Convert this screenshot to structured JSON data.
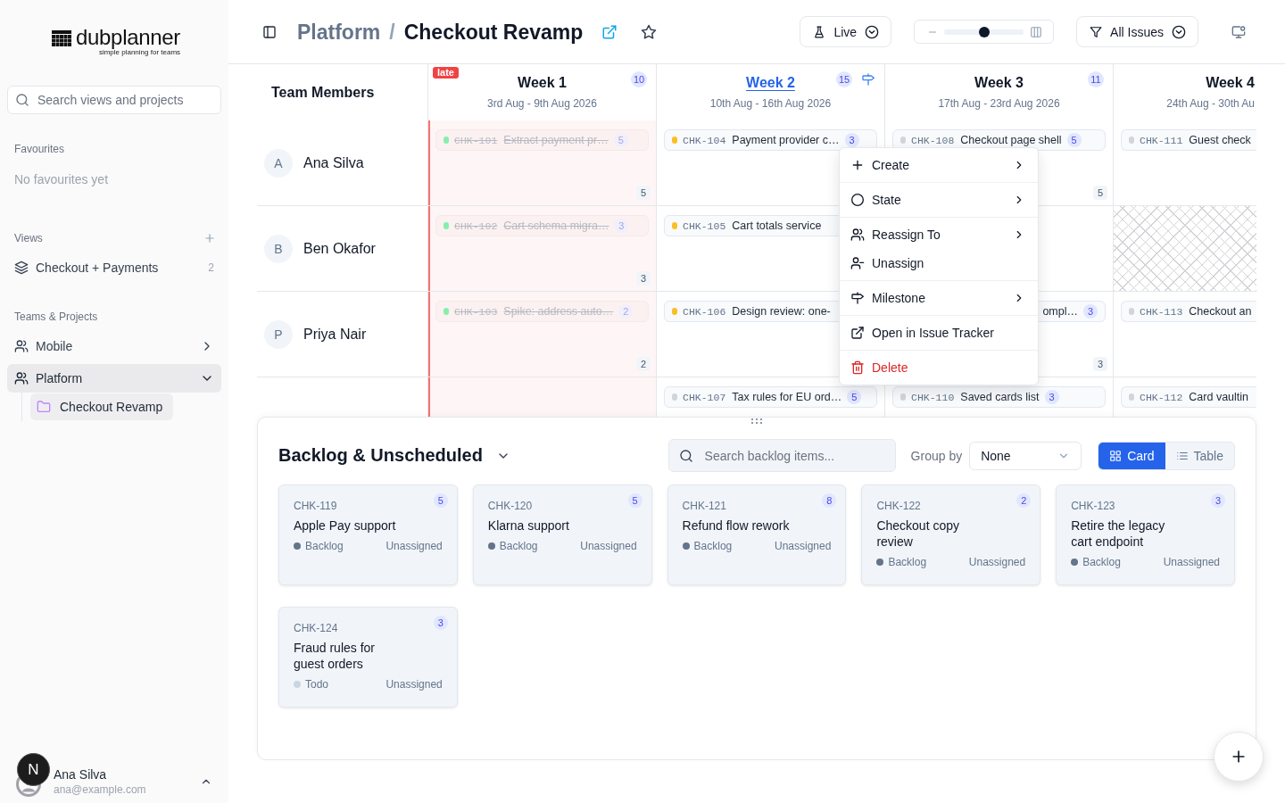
{
  "sidebar": {
    "logo": {
      "name": "dubplanner",
      "tagline": "simple planning for teams"
    },
    "search": {
      "placeholder": "Search views and projects"
    },
    "favourites": {
      "heading": "Favourites",
      "empty_text": "No favourites yet"
    },
    "views": {
      "heading": "Views",
      "items": [
        {
          "label": "Checkout + Payments",
          "count": "2"
        }
      ]
    },
    "teams": {
      "heading": "Teams & Projects",
      "items": [
        {
          "label": "Mobile",
          "selected": false,
          "expanded": false
        },
        {
          "label": "Platform",
          "selected": true,
          "expanded": true,
          "children": [
            {
              "label": "Checkout Revamp",
              "selected": true
            }
          ]
        }
      ]
    },
    "user": {
      "name": "Ana Silva",
      "email": "ana@example.com"
    },
    "dev_badge": {
      "label": "N"
    }
  },
  "header": {
    "breadcrumb": [
      {
        "label": "Platform",
        "current": false
      },
      {
        "label": "Checkout Revamp",
        "current": true
      }
    ],
    "separator": "/",
    "starred": false,
    "mode": {
      "label": "Live"
    },
    "zoom": {
      "level": 0.5
    },
    "filter": {
      "label": "All Issues"
    }
  },
  "planner": {
    "members_heading": "Team Members",
    "weeks": [
      {
        "title": "Week 1",
        "dates": "3rd Aug - 9th Aug 2026",
        "count": "10",
        "badge": "late",
        "past": true,
        "current": false,
        "milestone": false
      },
      {
        "title": "Week 2",
        "dates": "10th Aug - 16th Aug 2026",
        "count": "15",
        "past": false,
        "current": true,
        "milestone": true
      },
      {
        "title": "Week 3",
        "dates": "17th Aug - 23rd Aug 2026",
        "count": "11",
        "past": false,
        "current": false,
        "milestone": false
      },
      {
        "title": "Week 4",
        "dates": "24th Aug - 30th Au",
        "past": false,
        "current": false,
        "milestone": false
      }
    ],
    "rows": [
      {
        "member": {
          "initial": "A",
          "name": "Ana Silva"
        },
        "cells": [
          {
            "unavailable": false,
            "total": "5",
            "tasks": [
              {
                "id": "CHK-101",
                "title": "Extract payment pr…",
                "points": "5",
                "color": "#86efac",
                "done": true
              }
            ]
          },
          {
            "unavailable": false,
            "tasks": [
              {
                "id": "CHK-104",
                "title": "Payment provider c…",
                "points": "3",
                "color": "#fbbf24",
                "done": false
              }
            ]
          },
          {
            "unavailable": false,
            "total": "5",
            "tasks": [
              {
                "id": "CHK-108",
                "title": "Checkout page shell",
                "points": "5",
                "color": "#d1d5db",
                "done": false
              }
            ]
          },
          {
            "unavailable": false,
            "tasks": [
              {
                "id": "CHK-111",
                "title": "Guest check",
                "color": "#d1d5db",
                "done": false
              }
            ]
          }
        ]
      },
      {
        "member": {
          "initial": "B",
          "name": "Ben Okafor"
        },
        "cells": [
          {
            "unavailable": false,
            "total": "3",
            "tasks": [
              {
                "id": "CHK-102",
                "title": "Cart schema migra…",
                "points": "3",
                "color": "#86efac",
                "done": true
              }
            ]
          },
          {
            "unavailable": false,
            "tasks": [
              {
                "id": "CHK-105",
                "title": "Cart totals service",
                "color": "#fbbf24",
                "done": false
              }
            ]
          },
          {
            "unavailable": false
          },
          {
            "unavailable": true
          }
        ]
      },
      {
        "member": {
          "initial": "P",
          "name": "Priya Nair"
        },
        "cells": [
          {
            "unavailable": false,
            "total": "2",
            "tasks": [
              {
                "id": "CHK-103",
                "title": "Spike: address auto…",
                "points": "2",
                "color": "#86efac",
                "done": true
              }
            ]
          },
          {
            "unavailable": false,
            "tasks": [
              {
                "id": "CHK-106",
                "title": "Design review: one-",
                "color": "#fbbf24",
                "done": false
              }
            ]
          },
          {
            "unavailable": false,
            "total": "3",
            "tasks": [
              {
                "title": "ompl…",
                "points": "3",
                "done": false
              }
            ]
          },
          {
            "unavailable": false,
            "tasks": [
              {
                "id": "CHK-113",
                "title": "Checkout an",
                "color": "#d1d5db",
                "done": false
              }
            ]
          }
        ]
      },
      {
        "cells": [
          {
            "unavailable": false
          },
          {
            "unavailable": false,
            "tasks": [
              {
                "id": "CHK-107",
                "title": "Tax rules for EU ord…",
                "points": "5",
                "color": "#d1d5db",
                "done": false
              }
            ]
          },
          {
            "unavailable": false,
            "tasks": [
              {
                "id": "CHK-110",
                "title": "Saved cards list",
                "points": "3",
                "color": "#d1d5db",
                "done": false
              }
            ]
          },
          {
            "unavailable": false,
            "tasks": [
              {
                "id": "CHK-112",
                "title": "Card vaultin",
                "color": "#d1d5db",
                "done": false
              }
            ]
          }
        ]
      }
    ]
  },
  "context_menu": {
    "groups": [
      {
        "items": [
          {
            "label": "Create",
            "kind": "create",
            "submenu": true
          }
        ]
      },
      {
        "items": [
          {
            "label": "State",
            "kind": "state",
            "submenu": true
          }
        ]
      },
      {
        "items": [
          {
            "label": "Reassign To",
            "kind": "reassign",
            "submenu": true
          },
          {
            "label": "Unassign",
            "kind": "unassign",
            "submenu": false
          }
        ]
      },
      {
        "items": [
          {
            "label": "Milestone",
            "kind": "milestone",
            "submenu": true
          }
        ]
      },
      {
        "items": [
          {
            "label": "Open in Issue Tracker",
            "kind": "open",
            "submenu": false
          }
        ]
      },
      {
        "items": [
          {
            "label": "Delete",
            "kind": "delete",
            "submenu": false
          }
        ]
      }
    ]
  },
  "backlog": {
    "title": "Backlog & Unscheduled",
    "search": {
      "placeholder": "Search backlog items..."
    },
    "group_by": {
      "label": "Group by",
      "value": "None"
    },
    "views": [
      {
        "label": "Card",
        "kind": "card",
        "selected": true
      },
      {
        "label": "Table",
        "kind": "table",
        "selected": false
      }
    ],
    "cards": [
      {
        "id": "CHK-119",
        "title": "Apple Pay support",
        "points": "5",
        "status": "Backlog",
        "color": "#64748b",
        "assignee": "Unassigned"
      },
      {
        "id": "CHK-120",
        "title": "Klarna support",
        "points": "5",
        "status": "Backlog",
        "color": "#64748b",
        "assignee": "Unassigned"
      },
      {
        "id": "CHK-121",
        "title": "Refund flow rework",
        "points": "8",
        "status": "Backlog",
        "color": "#64748b",
        "assignee": "Unassigned"
      },
      {
        "id": "CHK-122",
        "title": "Checkout copy review",
        "points": "2",
        "status": "Backlog",
        "color": "#64748b",
        "assignee": "Unassigned"
      },
      {
        "id": "CHK-123",
        "title": "Retire the legacy cart endpoint",
        "points": "3",
        "status": "Backlog",
        "color": "#64748b",
        "assignee": "Unassigned"
      },
      {
        "id": "CHK-124",
        "title": "Fraud rules for guest orders",
        "points": "3",
        "status": "Todo",
        "color": "#cbd5e1",
        "assignee": "Unassigned"
      }
    ]
  }
}
